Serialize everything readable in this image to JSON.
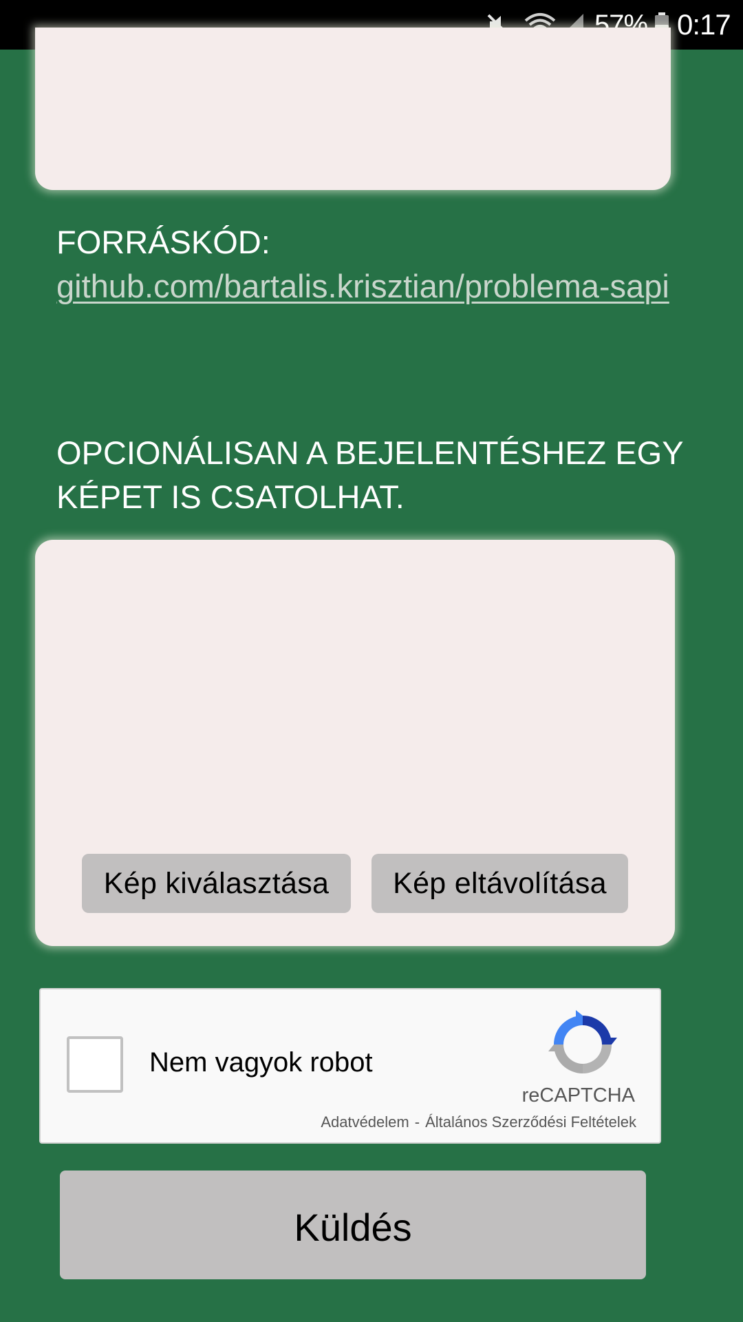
{
  "status_bar": {
    "battery_percent": "57%",
    "time": "0:17",
    "icons": [
      "mute-icon",
      "wifi-icon",
      "signal-icon",
      "battery-icon"
    ]
  },
  "source": {
    "label": "FORRÁSKÓD:",
    "link_text": "github.com/bartalis.krisztian/problema-sapi"
  },
  "optional_text": "OPCIONÁLISAN A BEJELENTÉSHEZ EGY KÉPET IS CSATOLHAT.",
  "image_card": {
    "select_button": "Kép kiválasztása",
    "remove_button": "Kép eltávolítása"
  },
  "recaptcha": {
    "label": "Nem vagyok robot",
    "brand": "reCAPTCHA",
    "privacy_link": "Adatvédelem",
    "separator": "-",
    "terms_link": "Általános Szerződési Feltételek"
  },
  "submit_button": "Küldés",
  "colors": {
    "background": "#267146",
    "card": "#f5eceb",
    "button": "#c1bfbf",
    "link": "#c9d6cc"
  }
}
